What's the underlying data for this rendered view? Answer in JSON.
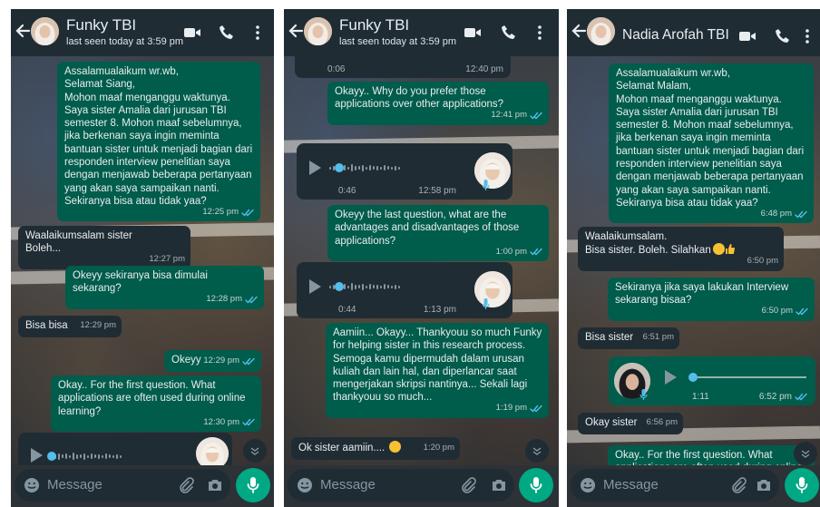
{
  "screens": [
    {
      "contact": "Funky TBI",
      "status": "last seen today at 3:59 pm",
      "messages": [
        {
          "text": "Assalamualaikum wr.wb,\nSelamat Siang,\nMohon maaf menganggu waktunya. Saya sister Amalia dari jurusan TBI semester 8. Mohon maaf sebelumnya, jika berkenan saya ingin meminta bantuan sister untuk menjadi bagian dari responden interview penelitian saya dengan menjawab beberapa pertanyaan yang akan saya sampaikan nanti. Sekiranya bisa atau tidak yaa?",
          "time": "12:25 pm"
        },
        {
          "text": "Waalaikumsalam sister\nBoleh...",
          "time": "12:27 pm"
        },
        {
          "text": "Okeyy sekiranya bisa dimulai sekarang?",
          "time": "12:28 pm"
        },
        {
          "text": "Bisa bisa",
          "time": "12:29 pm"
        },
        {
          "text": "Okeyy",
          "time": "12:29 pm"
        },
        {
          "text": "Okay.. For the first question. What applications are often used during online learning?",
          "time": "12:30 pm"
        }
      ],
      "input_placeholder": "Message"
    },
    {
      "contact": "Funky TBI",
      "status": "last seen today at 3:59 pm",
      "voice_top": {
        "duration": "0:06",
        "time": "12:40 pm"
      },
      "messages": [
        {
          "text": "Okayy.. Why do you prefer those applications over other applications?",
          "time": "12:41 pm"
        },
        {
          "text": "Okeyy the last question, what are the advantages and disadvantages of those applications?",
          "time": "1:00 pm"
        },
        {
          "text": "Aamiin... Okayy... Thankyouu so much Funky for helping sister in this research process. Semoga kamu dipermudah dalam urusan kuliah dan lain hal, dan diperlancar saat mengerjakan skripsi nantinya... Sekali lagi thankyouu so much...",
          "time": "1:19 pm"
        },
        {
          "text": "Ok sister aamiin....",
          "time": "1:20 pm"
        }
      ],
      "voices": [
        {
          "duration": "0:46",
          "time": "12:58 pm"
        },
        {
          "duration": "0:44",
          "time": "1:13 pm"
        }
      ],
      "input_placeholder": "Message"
    },
    {
      "contact": "Nadia Arofah TBI",
      "messages": [
        {
          "text": "Assalamualaikum wr.wb,\nSelamat Malam,\nMohon maaf menganggu waktunya. Saya sister Amalia dari jurusan TBI semester 8. Mohon maaf sebelumnya, jika berkenan saya ingin meminta bantuan sister untuk menjadi bagian dari responden interview penelitian saya dengan menjawab beberapa pertanyaan yang akan saya sampaikan nanti. Sekiranya bisa atau tidak yaa?",
          "time": "6:48 pm"
        },
        {
          "text": "Waalaikumsalam.\nBisa sister. Boleh. Silahkan",
          "time": "6:50 pm"
        },
        {
          "text": "Sekiranya jika saya lakukan Interview sekarang bisaa?",
          "time": "6:50 pm"
        },
        {
          "text": "Bisa sister",
          "time": "6:51 pm"
        },
        {
          "text": "Okay sister",
          "time": "6:56 pm"
        },
        {
          "text": "Okay.. For the first question. What applications are often used during online",
          "time": ""
        }
      ],
      "voices": [
        {
          "duration": "1:11",
          "time": "6:52 pm"
        }
      ],
      "input_placeholder": "Message"
    }
  ],
  "colors": {
    "header": "#1f2c34",
    "outgoing": "#005c4b",
    "incoming": "#202c33",
    "accent": "#00a884",
    "read_ticks": "#53bdeb"
  }
}
